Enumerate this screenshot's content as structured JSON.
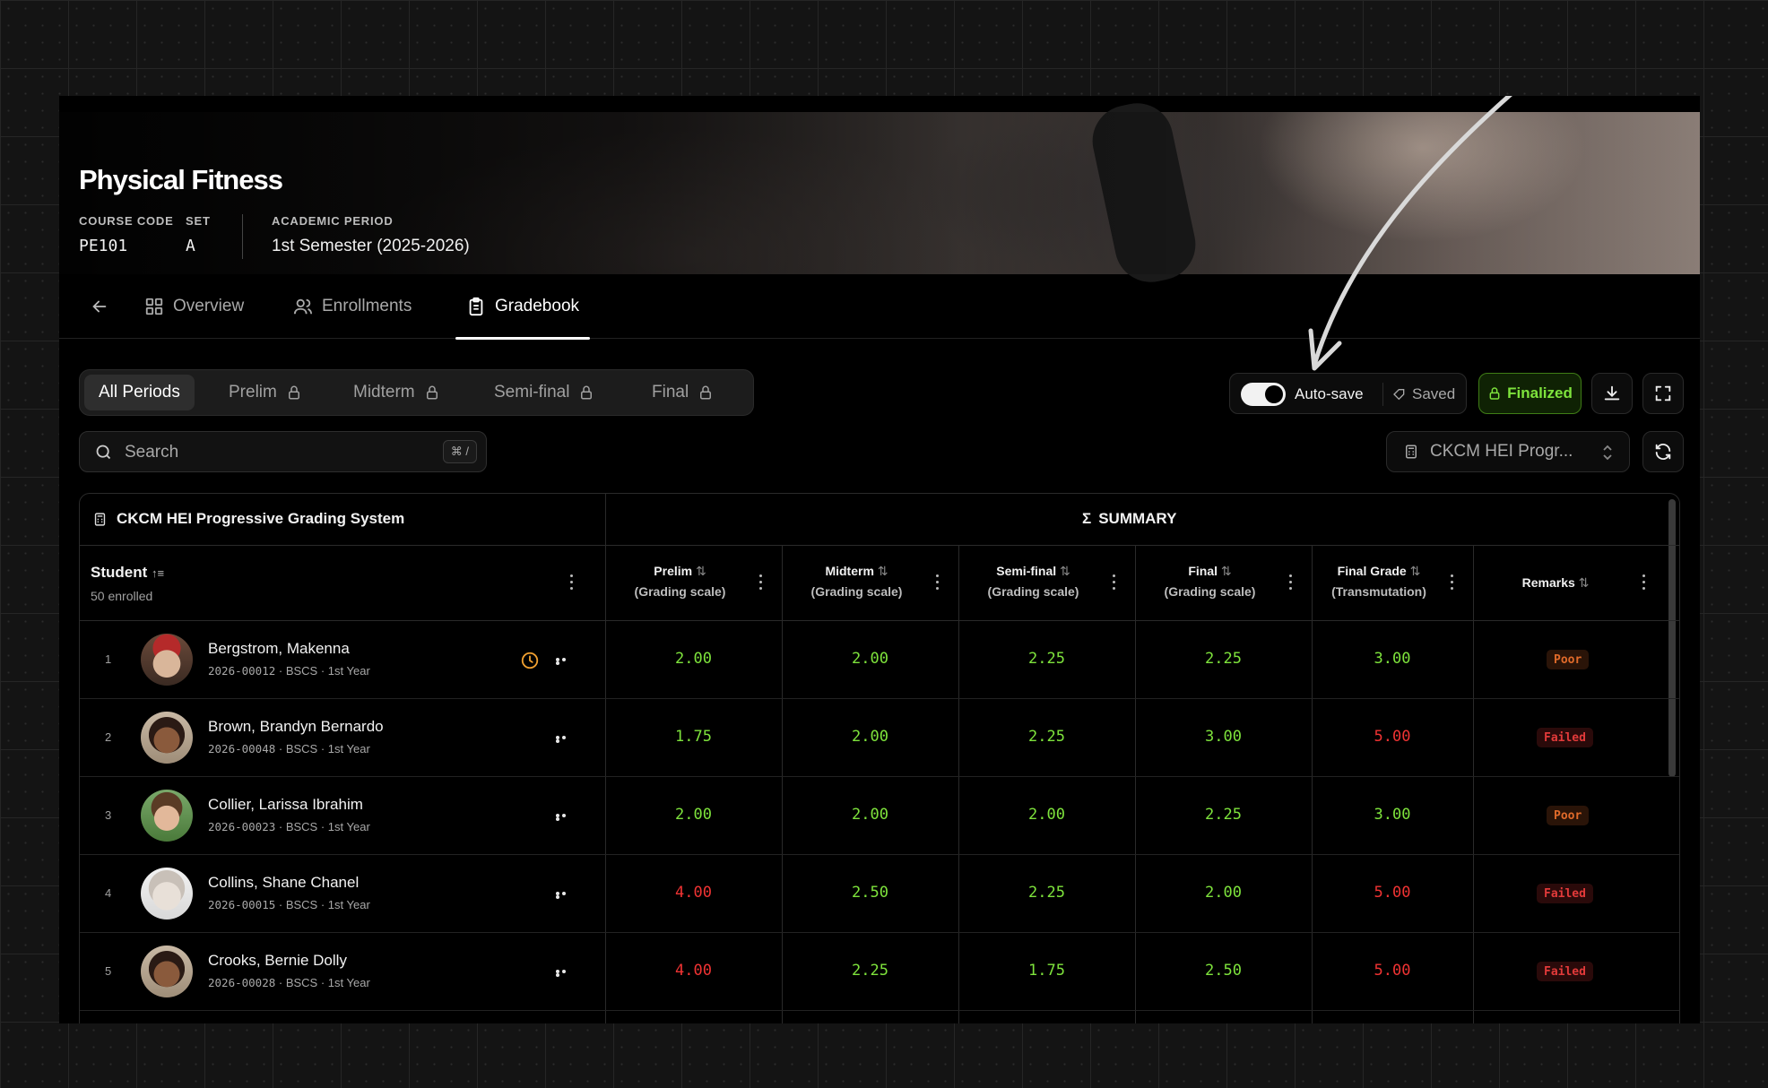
{
  "course": {
    "title": "Physical Fitness",
    "code_label": "COURSE CODE",
    "code": "PE101",
    "set_label": "SET",
    "set": "A",
    "period_label": "ACADEMIC PERIOD",
    "period": "1st Semester (2025-2026)"
  },
  "tabs": [
    {
      "label": "Overview",
      "icon": "grid-icon"
    },
    {
      "label": "Enrollments",
      "icon": "users-icon"
    },
    {
      "label": "Gradebook",
      "icon": "clipboard-icon",
      "active": true
    }
  ],
  "periods": [
    {
      "label": "All Periods",
      "active": true,
      "locked": false
    },
    {
      "label": "Prelim",
      "locked": true
    },
    {
      "label": "Midterm",
      "locked": true
    },
    {
      "label": "Semi-final",
      "locked": true
    },
    {
      "label": "Final",
      "locked": true
    }
  ],
  "toolbar": {
    "autosave_label": "Auto-save",
    "autosave_on": true,
    "saved_label": "Saved",
    "finalized_label": "Finalized"
  },
  "search": {
    "placeholder": "Search",
    "shortcut": "⌘ /"
  },
  "grading_system_select": "CKCM HEI Progr...",
  "table": {
    "grading_system": "CKCM HEI Progressive Grading System",
    "summary_label": "SUMMARY",
    "student_header": "Student",
    "enrolled": "50 enrolled",
    "columns": [
      {
        "label": "Prelim",
        "sub": "(Grading scale)"
      },
      {
        "label": "Midterm",
        "sub": "(Grading scale)"
      },
      {
        "label": "Semi-final",
        "sub": "(Grading scale)"
      },
      {
        "label": "Final",
        "sub": "(Grading scale)"
      },
      {
        "label": "Final Grade",
        "sub": "(Transmutation)"
      },
      {
        "label": "Remarks",
        "sub": ""
      }
    ],
    "rows": [
      {
        "n": "1",
        "name": "Bergstrom, Makenna",
        "id": "2026-00012",
        "program": "BSCS · 1st Year",
        "pending": true,
        "grades": [
          "2.00",
          "2.00",
          "2.25",
          "2.25"
        ],
        "final": "3.00",
        "remark": "Poor"
      },
      {
        "n": "2",
        "name": "Brown, Brandyn Bernardo",
        "id": "2026-00048",
        "program": "BSCS · 1st Year",
        "pending": false,
        "grades": [
          "1.75",
          "2.00",
          "2.25",
          "3.00"
        ],
        "final": "5.00",
        "remark": "Failed"
      },
      {
        "n": "3",
        "name": "Collier, Larissa Ibrahim",
        "id": "2026-00023",
        "program": "BSCS · 1st Year",
        "pending": false,
        "grades": [
          "2.00",
          "2.00",
          "2.00",
          "2.25"
        ],
        "final": "3.00",
        "remark": "Poor"
      },
      {
        "n": "4",
        "name": "Collins, Shane Chanel",
        "id": "2026-00015",
        "program": "BSCS · 1st Year",
        "pending": false,
        "grades": [
          "4.00",
          "2.50",
          "2.25",
          "2.00"
        ],
        "final": "5.00",
        "remark": "Failed"
      },
      {
        "n": "5",
        "name": "Crooks, Bernie Dolly",
        "id": "2026-00028",
        "program": "BSCS · 1st Year",
        "pending": false,
        "grades": [
          "4.00",
          "2.25",
          "1.75",
          "2.50"
        ],
        "final": "5.00",
        "remark": "Failed"
      }
    ]
  },
  "colors": {
    "pass": "#7ee33c",
    "fail": "#f03333",
    "poor": "#e06a2a",
    "pending": "#f0a030"
  }
}
